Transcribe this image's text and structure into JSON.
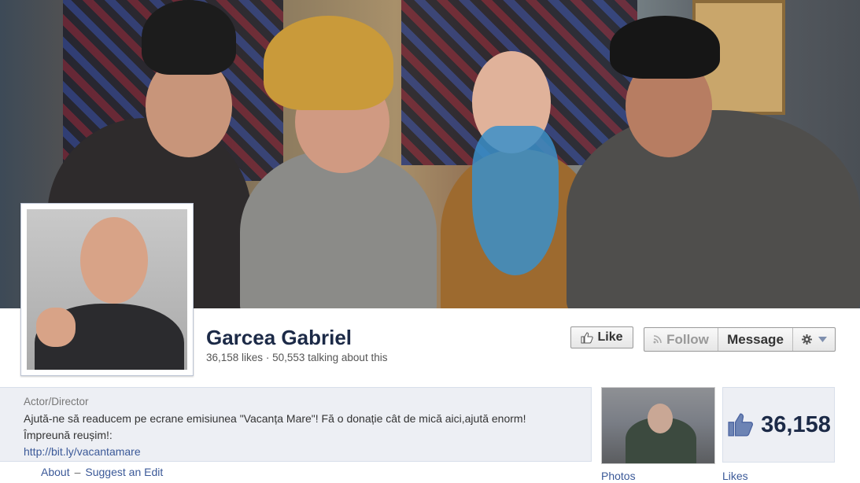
{
  "page": {
    "name": "Garcea Gabriel",
    "likes_text": "36,158 likes",
    "separator": "·",
    "talking_text": "50,553 talking about this"
  },
  "actions": {
    "like_label": "Like",
    "follow_label": "Follow",
    "message_label": "Message"
  },
  "about": {
    "category": "Actor/Director",
    "description_line1": "Ajută-ne să readucem pe ecrane emisiunea \"Vacanța Mare\"! Fă o donație cât de mică aici,ajută enorm!",
    "description_line2": "Împreună reușim!:",
    "link": "http://bit.ly/vacantamare",
    "about_label": "About",
    "dash": "–",
    "suggest_label": "Suggest an Edit"
  },
  "apps": {
    "photos_label": "Photos",
    "likes_count": "36,158",
    "likes_label": "Likes"
  },
  "colors": {
    "link": "#3b5998",
    "name": "#1c2a47",
    "panel_bg": "#edeff4"
  },
  "icons": [
    "thumbs-up-icon",
    "rss-icon",
    "gear-icon",
    "caret-down-icon"
  ]
}
